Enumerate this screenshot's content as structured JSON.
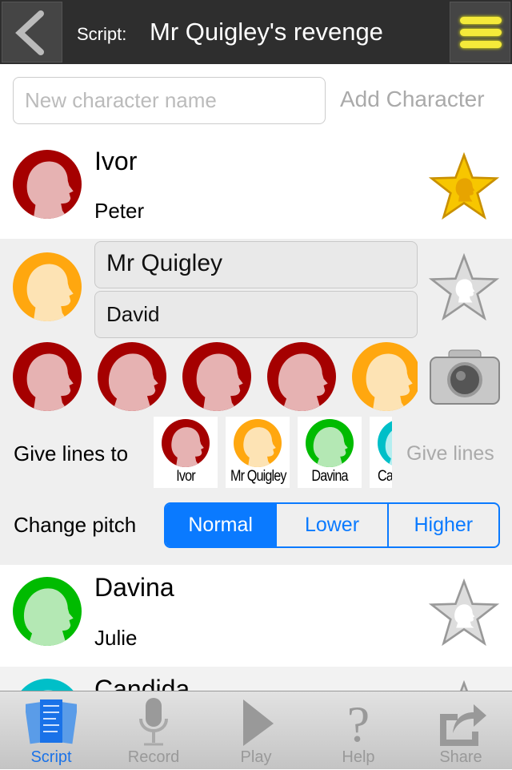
{
  "header": {
    "title_label": "Script:",
    "title": "Mr Quigley's revenge",
    "back_icon": "chevron-left-icon",
    "menu_icon": "hamburger-menu-icon"
  },
  "new_character": {
    "placeholder": "New character name",
    "value": "",
    "add_label": "Add Character"
  },
  "colors": {
    "red": "#a50000",
    "orange": "#ffa70f",
    "green": "#00bb00",
    "teal": "#00bfc8",
    "accent": "#0a7aff",
    "star_gold": "#f7c600"
  },
  "characters": [
    {
      "name": "Ivor",
      "actor": "Peter",
      "color": "#a50000",
      "starred": true
    },
    {
      "name": "Mr Quigley",
      "actor": "David",
      "color": "#ffa70f",
      "starred": false,
      "expanded": true
    },
    {
      "name": "Davina",
      "actor": "Julie",
      "color": "#00bb00",
      "starred": false
    },
    {
      "name": "Candida",
      "color": "#00bfc8"
    }
  ],
  "editor": {
    "avatar_choices": [
      "red-male",
      "red-female",
      "red-male",
      "red-male",
      "orange-male"
    ],
    "camera_icon": "camera-icon",
    "give_lines_label": "Give lines to",
    "give_lines_targets": [
      "Ivor",
      "Mr Quigley",
      "Davina",
      "Candida"
    ],
    "give_lines_button": "Give lines",
    "pitch_label": "Change pitch",
    "pitch_options": [
      "Normal",
      "Lower",
      "Higher"
    ],
    "pitch_selected": "Normal"
  },
  "tabbar": {
    "tabs": [
      {
        "label": "Script",
        "active": true
      },
      {
        "label": "Record"
      },
      {
        "label": "Play"
      },
      {
        "label": "Help"
      },
      {
        "label": "Share"
      }
    ]
  }
}
